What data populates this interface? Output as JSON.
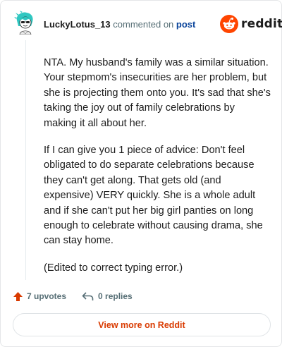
{
  "header": {
    "username": "LuckyLotus_13",
    "commented_text": "commented on",
    "post_link": "post"
  },
  "brand": {
    "name": "reddit",
    "icon": "reddit-snoo-icon",
    "color": "#ff4500"
  },
  "comment": {
    "paragraphs": [
      "NTA. My husband's family was a similar situation. Your stepmom's insecurities are her problem, but she is projecting them onto you. It's sad that she's taking the joy out of family celebrations by making it all about her.",
      "If I can give you 1 piece of advice: Don't feel obligated to do separate celebrations because they can't get along. That gets old (and expensive) VERY quickly. She is a whole adult and if she can't put her big girl panties on long enough to celebrate without causing drama, she can stay home.",
      "(Edited to correct typing error.)"
    ]
  },
  "actions": {
    "upvotes": "7 upvotes",
    "upvote_icon": "upvote-arrow-icon",
    "upvote_color": "#d93a00",
    "replies": "0 replies",
    "reply_icon": "reply-arrow-icon"
  },
  "footer": {
    "view_more_label": "View more on Reddit",
    "accent": "#d93a00"
  }
}
